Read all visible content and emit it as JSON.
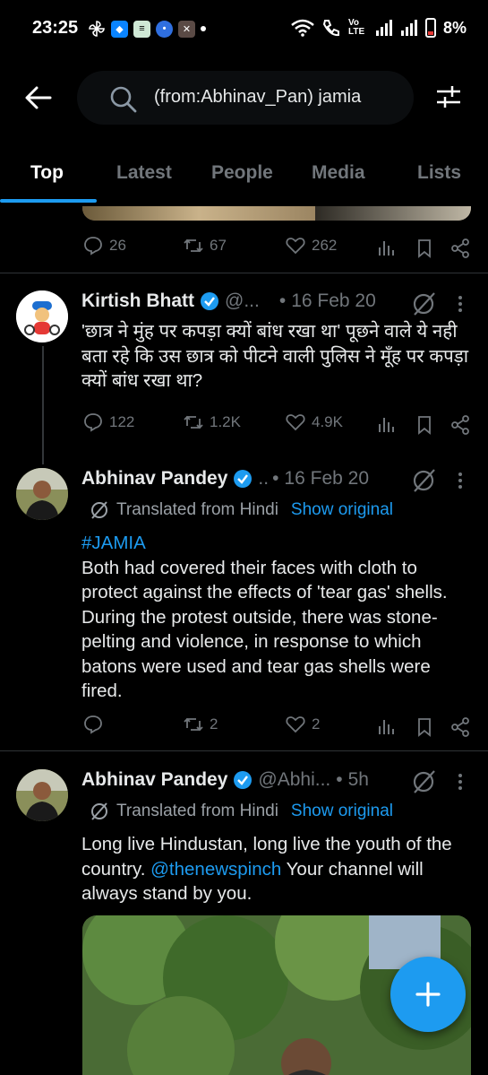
{
  "status_bar": {
    "time": "23:25",
    "battery": "8%",
    "volte": "Vo LTE"
  },
  "search": {
    "query": "(from:Abhinav_Pan)  jamia"
  },
  "tabs": [
    {
      "label": "Top",
      "active": true
    },
    {
      "label": "Latest",
      "active": false
    },
    {
      "label": "People",
      "active": false
    },
    {
      "label": "Media",
      "active": false
    },
    {
      "label": "Lists",
      "active": false
    }
  ],
  "tweets": [
    {
      "replies": "26",
      "retweets": "67",
      "likes": "262"
    },
    {
      "name": "Kirtish Bhatt",
      "handle": "@...",
      "dot": "•",
      "time": "16 Feb 20",
      "text": "'छात्र ने मुंह पर कपड़ा क्यों बांध रखा था' पूछने वाले ये नही बता रहे कि उस छात्र को पीटने वाली पुलिस ने मूँह पर कपड़ा क्यों बांध रखा था?",
      "replies": "122",
      "retweets": "1.2K",
      "likes": "4.9K"
    },
    {
      "name": "Abhinav Pandey",
      "handle": "..",
      "dot": "•",
      "time": "16 Feb 20",
      "translated": "Translated from Hindi",
      "show_original": "Show original",
      "hashtag": "#JAMIA",
      "text": "Both had covered their faces with cloth to protect against the effects of 'tear gas' shells. During the protest outside, there was stone-pelting and violence, in response to which batons were used and tear gas shells were fired.",
      "replies": "",
      "retweets": "2",
      "likes": "2"
    },
    {
      "name": "Abhinav Pandey",
      "handle": "@Abhi...",
      "dot": "•",
      "time": "5h",
      "translated": "Translated from Hindi",
      "show_original": "Show original",
      "text_before": "Long live Hindustan, long live the youth of the country. ",
      "mention": "@thenewspinch",
      "text_after": " Your channel will always stand by you."
    }
  ],
  "colors": {
    "accent": "#1d9bf0",
    "muted": "#71767b",
    "divider": "#2f3336"
  }
}
